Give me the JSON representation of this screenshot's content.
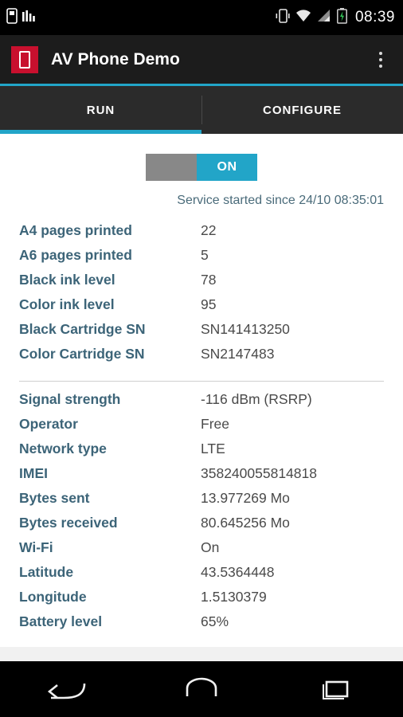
{
  "statusbar": {
    "clock": "08:39",
    "icons": [
      "sim-card-icon",
      "signal-bars-icon",
      "vibrate-icon",
      "wifi-icon",
      "cell-signal-icon",
      "battery-charging-icon"
    ]
  },
  "actionbar": {
    "app_icon": "phone-app-icon",
    "title": "AV Phone Demo",
    "overflow": "overflow-menu-icon"
  },
  "tabs": [
    {
      "label": "RUN",
      "selected": true
    },
    {
      "label": "CONFIGURE",
      "selected": false
    }
  ],
  "service_toggle": {
    "state_label": "ON",
    "checked": true
  },
  "service_status": "Service started since 24/10 08:35:01",
  "printer_stats": [
    {
      "key": "A4 pages printed",
      "value": "22"
    },
    {
      "key": "A6 pages printed",
      "value": "5"
    },
    {
      "key": "Black ink level",
      "value": "78"
    },
    {
      "key": "Color ink level",
      "value": "95"
    },
    {
      "key": "Black Cartridge SN",
      "value": "SN141413250"
    },
    {
      "key": "Color Cartridge SN",
      "value": "SN2147483"
    }
  ],
  "device_stats": [
    {
      "key": "Signal strength",
      "value": "-116 dBm (RSRP)"
    },
    {
      "key": "Operator",
      "value": "Free"
    },
    {
      "key": "Network type",
      "value": "LTE"
    },
    {
      "key": "IMEI",
      "value": "358240055814818"
    },
    {
      "key": "Bytes sent",
      "value": "13.977269 Mo"
    },
    {
      "key": "Bytes received",
      "value": "80.645256 Mo"
    },
    {
      "key": "Wi-Fi",
      "value": "On"
    },
    {
      "key": "Latitude",
      "value": "43.5364448"
    },
    {
      "key": "Longitude",
      "value": "1.5130379"
    },
    {
      "key": "Battery level",
      "value": "65%"
    }
  ],
  "navbar": {
    "back": "back-icon",
    "home": "home-icon",
    "recents": "recents-icon"
  },
  "colors": {
    "accent": "#22a5c8",
    "key_text": "#3c6478",
    "value_text": "#4a4a4a",
    "app_icon_bg": "#c8102e",
    "actionbar_bg": "#1c1c1c",
    "tabbar_bg": "#2b2b2b"
  }
}
